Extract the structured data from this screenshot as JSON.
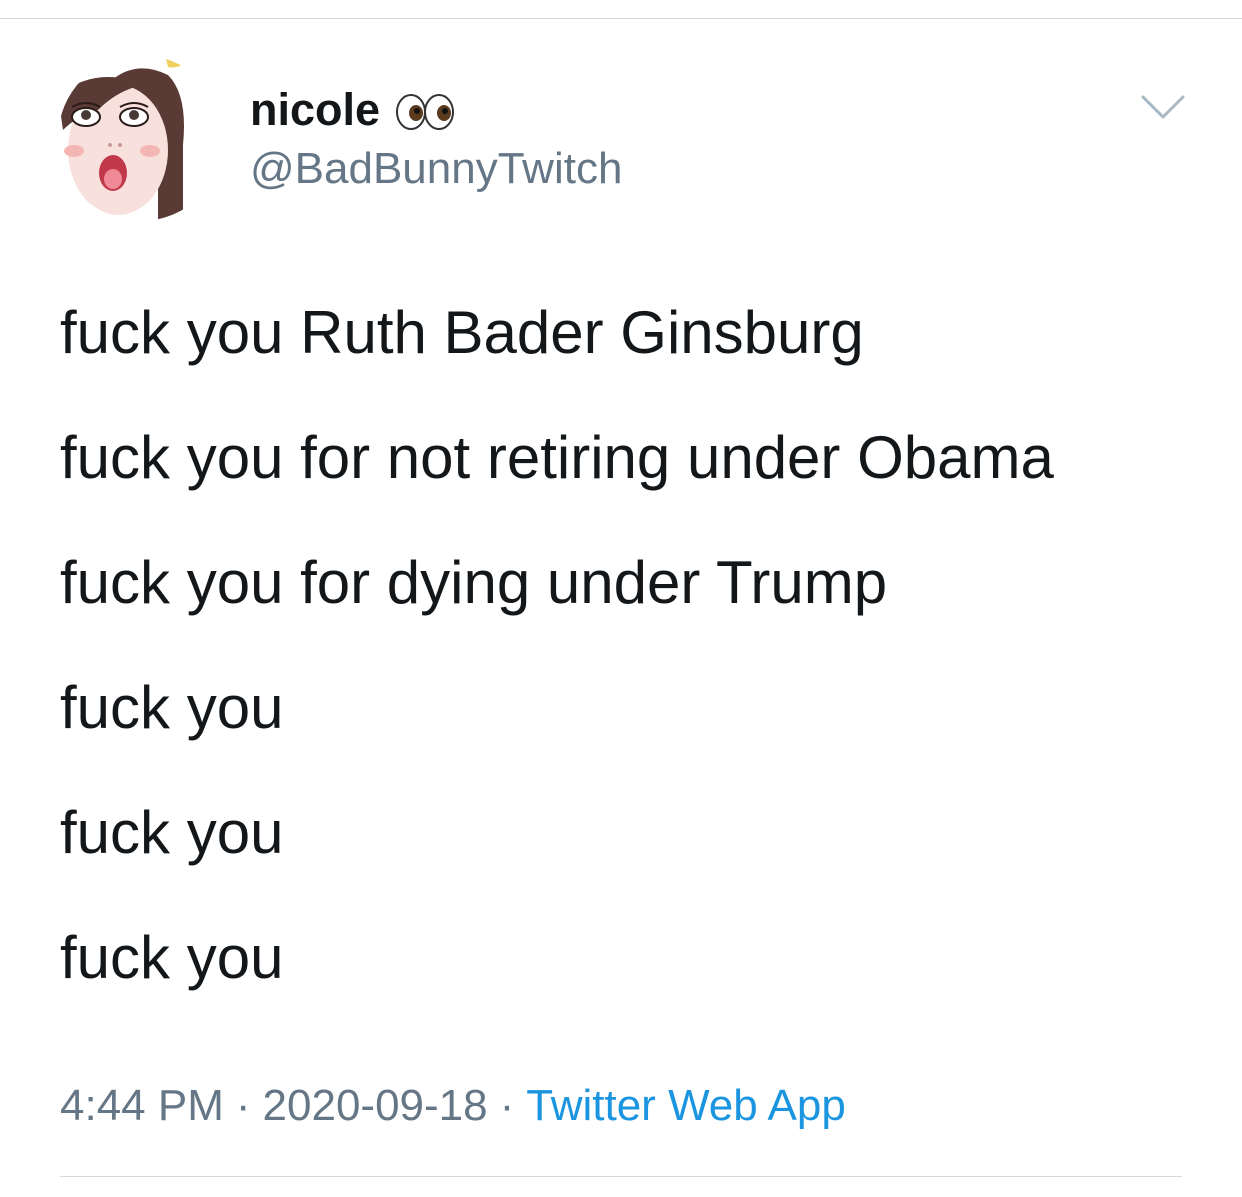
{
  "tweet": {
    "author": {
      "display_name": "nicole",
      "name_emoji": "eyes-icon",
      "handle": "@BadBunnyTwitch",
      "avatar": "avatar-illustration"
    },
    "lines": [
      "fuck you Ruth Bader Ginsburg",
      "fuck you for not retiring under Obama",
      "fuck you for dying under Trump",
      "fuck you",
      "fuck you",
      "fuck you"
    ],
    "time": "4:44 PM",
    "separator": "·",
    "date": "2020-09-18",
    "source": "Twitter Web App"
  },
  "icons": {
    "more": "chevron-down-icon"
  },
  "colors": {
    "text_primary": "#14171a",
    "text_secondary": "#657786",
    "link": "#1b95e0",
    "divider": "#d6d9db"
  }
}
